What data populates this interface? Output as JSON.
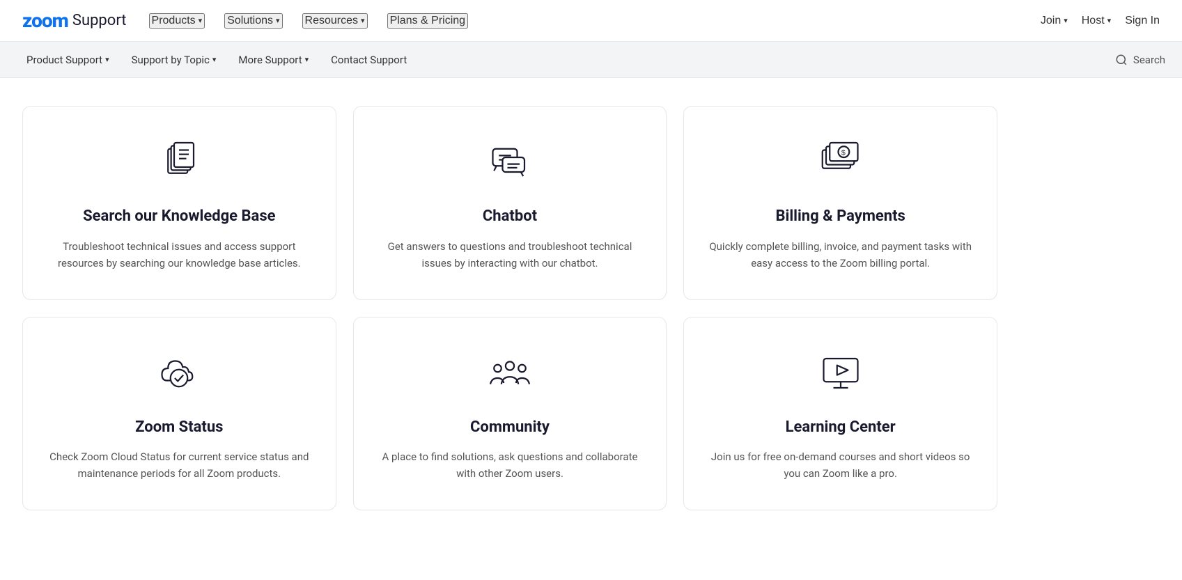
{
  "topNav": {
    "logo_zoom": "zoom",
    "logo_support": "Support",
    "links": [
      {
        "label": "Products",
        "id": "products",
        "hasChevron": true
      },
      {
        "label": "Solutions",
        "id": "solutions",
        "hasChevron": true
      },
      {
        "label": "Resources",
        "id": "resources",
        "hasChevron": true
      },
      {
        "label": "Plans & Pricing",
        "id": "plans-pricing",
        "hasChevron": false
      }
    ],
    "right": [
      {
        "label": "Join",
        "id": "join",
        "hasChevron": true
      },
      {
        "label": "Host",
        "id": "host",
        "hasChevron": true
      },
      {
        "label": "Sign In",
        "id": "sign-in",
        "hasChevron": false
      }
    ]
  },
  "subNav": {
    "items": [
      {
        "label": "Product Support",
        "id": "product-support",
        "hasChevron": true
      },
      {
        "label": "Support by Topic",
        "id": "support-by-topic",
        "hasChevron": true
      },
      {
        "label": "More Support",
        "id": "more-support",
        "hasChevron": true
      },
      {
        "label": "Contact Support",
        "id": "contact-support",
        "hasChevron": false
      }
    ],
    "search_label": "Search"
  },
  "cards": [
    {
      "id": "knowledge-base",
      "title": "Search our Knowledge Base",
      "description": "Troubleshoot technical issues and access support resources by searching our knowledge base articles.",
      "icon": "documents"
    },
    {
      "id": "chatbot",
      "title": "Chatbot",
      "description": "Get answers to questions and troubleshoot technical issues by interacting with our chatbot.",
      "icon": "chat"
    },
    {
      "id": "billing-payments",
      "title": "Billing & Payments",
      "description": "Quickly complete billing, invoice, and payment tasks with easy access to the Zoom billing portal.",
      "icon": "billing"
    },
    {
      "id": "zoom-status",
      "title": "Zoom Status",
      "description": "Check Zoom Cloud Status for current service status and maintenance periods for all Zoom products.",
      "icon": "cloud-check"
    },
    {
      "id": "community",
      "title": "Community",
      "description": "A place to find solutions, ask questions and collaborate with other Zoom users.",
      "icon": "community"
    },
    {
      "id": "learning-center",
      "title": "Learning Center",
      "description": "Join us for free on-demand courses and short videos so you can Zoom like a pro.",
      "icon": "learning"
    }
  ]
}
